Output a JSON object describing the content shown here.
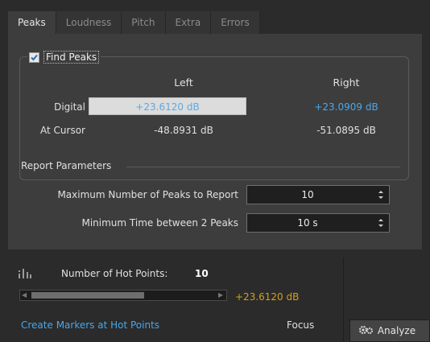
{
  "tabs": [
    {
      "label": "Peaks",
      "active": true
    },
    {
      "label": "Loudness",
      "active": false
    },
    {
      "label": "Pitch",
      "active": false
    },
    {
      "label": "Extra",
      "active": false
    },
    {
      "label": "Errors",
      "active": false
    }
  ],
  "find_peaks": {
    "label": "Find Peaks",
    "checked": true
  },
  "peaks_table": {
    "headers": {
      "left": "Left",
      "right": "Right"
    },
    "digital": {
      "label": "Digital",
      "left": "+23.6120 dB",
      "right": "+23.0909 dB"
    },
    "at_cursor": {
      "label": "At Cursor",
      "left": "-48.8931 dB",
      "right": "-51.0895 dB"
    }
  },
  "report": {
    "title": "Report Parameters",
    "max_peaks": {
      "label": "Maximum Number of Peaks to Report",
      "value": "10"
    },
    "min_time": {
      "label": "Minimum Time between 2 Peaks",
      "value": "10 s"
    }
  },
  "hot_points": {
    "label": "Number of Hot Points:",
    "count": "10",
    "value": "+23.6120 dB"
  },
  "create_markers_link": "Create Markers at Hot Points",
  "focus_label": "Focus",
  "analyze_button": "Analyze",
  "colors": {
    "accent_blue": "#4aa7ea",
    "accent_orange": "#d4a017",
    "link": "#4aa7ea"
  }
}
